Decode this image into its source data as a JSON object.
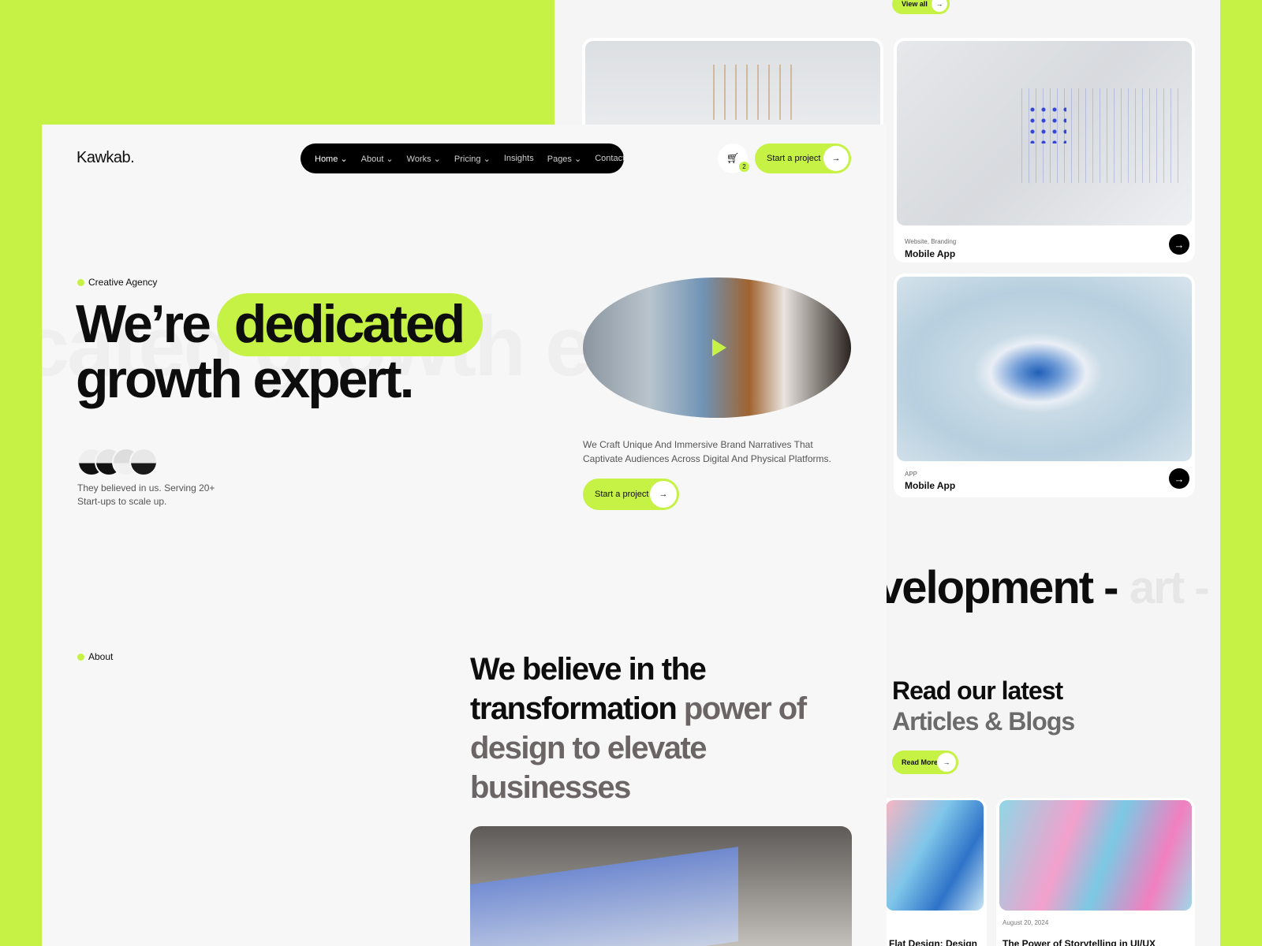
{
  "colors": {
    "accent": "#c6f145",
    "dark": "#000000",
    "panel": "#f7f7f7"
  },
  "back_page": {
    "view_all_label": "View all",
    "projects": [
      {
        "tag": "Website, Branding",
        "title": "Mobile App"
      },
      {
        "tag": "APP",
        "title": "Mobile App"
      }
    ],
    "marquee": {
      "active": "velopment -",
      "faded": "art -"
    },
    "blog_heading": {
      "line1": "Read our latest",
      "line2": "Articles & Blogs"
    },
    "read_more_label": "Read More",
    "posts": [
      {
        "date": "",
        "title": "Flat Design: Design"
      },
      {
        "date": "August 20, 2024",
        "title": "The Power of Storytelling in UI/UX"
      }
    ]
  },
  "header": {
    "logo": "Kawkab.",
    "nav": [
      {
        "label": "Home",
        "dropdown": true
      },
      {
        "label": "About",
        "dropdown": true
      },
      {
        "label": "Works",
        "dropdown": true
      },
      {
        "label": "Pricing",
        "dropdown": true
      },
      {
        "label": "Insights",
        "dropdown": false
      },
      {
        "label": "Pages",
        "dropdown": true
      },
      {
        "label": "Contact",
        "dropdown": false
      }
    ],
    "cart_count": "2",
    "cta_label": "Start a project"
  },
  "hero": {
    "eyebrow": "Creative Agency",
    "title_pre": "We’re",
    "title_highlight": "dedicated",
    "title_line2": "growth expert.",
    "bg_text": "dedicated growth expert",
    "social_proof": "They believed in us. Serving 20+ Start-ups to scale up.",
    "description": "We Craft Unique And Immersive Brand Narratives That Captivate Audiences Across Digital And Physical Platforms.",
    "cta_label": "Start a project"
  },
  "about": {
    "eyebrow": "About",
    "heading_dark": "We believe in the transformation",
    "heading_light": "power of design to elevate businesses"
  }
}
